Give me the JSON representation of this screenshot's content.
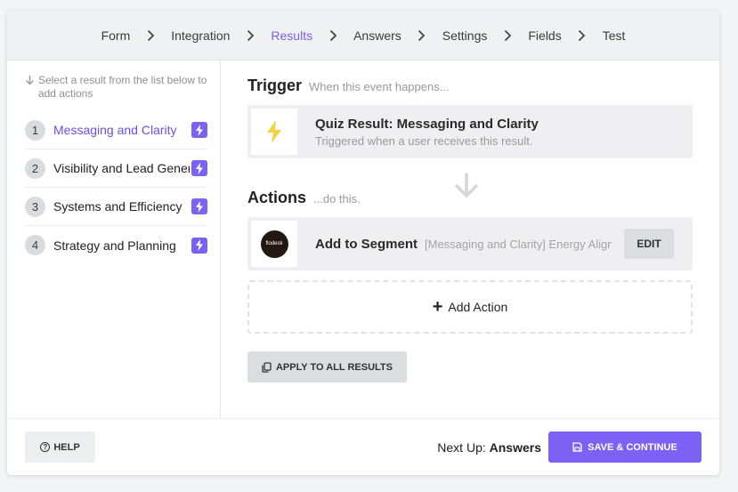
{
  "breadcrumb": [
    "Form",
    "Integration",
    "Results",
    "Answers",
    "Settings",
    "Fields",
    "Test"
  ],
  "breadcrumb_active": "Results",
  "sidebar": {
    "hint": "Select a result from the list below to add actions",
    "results": [
      {
        "num": "1",
        "label": "Messaging and Clarity"
      },
      {
        "num": "2",
        "label": "Visibility and Lead Generation"
      },
      {
        "num": "3",
        "label": "Systems and Efficiency"
      },
      {
        "num": "4",
        "label": "Strategy and Planning"
      }
    ]
  },
  "trigger": {
    "title": "Trigger",
    "subtitle": "When this event happens...",
    "name": "Quiz Result: Messaging and Clarity",
    "description": "Triggered when a user receives this result."
  },
  "actions": {
    "title": "Actions",
    "subtitle": "...do this.",
    "items": [
      {
        "logo_text": "flodesk",
        "name": "Add to Segment",
        "detail": "[Messaging and Clarity] Energy Alignment Quiz",
        "edit_label": "EDIT"
      }
    ],
    "add_label": "Add Action",
    "apply_label": "APPLY TO ALL RESULTS"
  },
  "footer": {
    "help_label": "HELP",
    "next_prefix": "Next Up:",
    "next_value": "Answers",
    "save_label": "SAVE & CONTINUE"
  },
  "colors": {
    "accent": "#7b61f4",
    "active_text": "#6b4fe8",
    "trigger_icon": "#f5d33b"
  }
}
